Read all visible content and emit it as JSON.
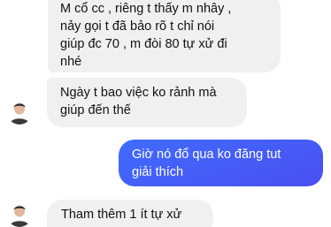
{
  "messages": [
    {
      "side": "incoming",
      "text": "M cổ cc , riêng t thấy m nhây ,\nnảy gọi t đã bảo rõ t chỉ nói\ngiúp đc 70 , m đòi 80 tự xử đi\nnhé"
    },
    {
      "side": "incoming",
      "text": "Ngày t bao việc ko rảnh mà\ngiúp đến thế"
    },
    {
      "side": "outgoing",
      "text": "Giờ nó đổ qua ko đăng tut\ngiải thích"
    },
    {
      "side": "incoming",
      "text": "Tham thêm 1 ít tự xử"
    }
  ],
  "colors": {
    "incoming_bubble": "#f1f0f0",
    "outgoing_bubble": "#3d5cff",
    "background": "#ffffff"
  },
  "icons": {
    "avatar": "contact-avatar-icon"
  }
}
